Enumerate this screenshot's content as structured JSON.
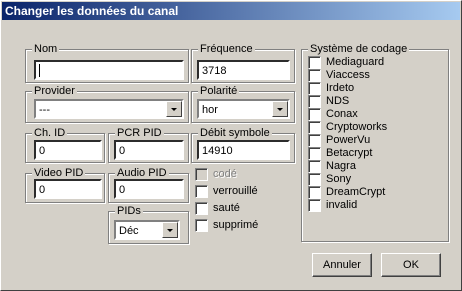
{
  "window": {
    "title": "Changer les données du canal"
  },
  "nom": {
    "label": "Nom",
    "value": ""
  },
  "frequence": {
    "label": "Fréquence",
    "value": "3718"
  },
  "provider": {
    "label": "Provider",
    "value": "---"
  },
  "polarite": {
    "label": "Polarité",
    "value": "hor"
  },
  "ch_id": {
    "label": "Ch. ID",
    "value": "0"
  },
  "pcr_pid": {
    "label": "PCR PID",
    "value": "0"
  },
  "debit_symbole": {
    "label": "Débit symbole",
    "value": "14910"
  },
  "video_pid": {
    "label": "Video PID",
    "value": "0"
  },
  "audio_pid": {
    "label": "Audio PID",
    "value": "0"
  },
  "pids": {
    "label": "PIDs",
    "value": "Déc"
  },
  "flags": [
    {
      "label": "codé",
      "enabled": false
    },
    {
      "label": "verrouillé",
      "enabled": true
    },
    {
      "label": "sauté",
      "enabled": true
    },
    {
      "label": "supprimé",
      "enabled": true
    }
  ],
  "systeme": {
    "label": "Système de codage",
    "items": [
      "Mediaguard",
      "Viaccess",
      "Irdeto",
      "NDS",
      "Conax",
      "Cryptoworks",
      "PowerVu",
      "Betacrypt",
      "Nagra",
      "Sony",
      "DreamCrypt",
      "invalid"
    ]
  },
  "buttons": {
    "cancel": "Annuler",
    "ok": "OK"
  }
}
